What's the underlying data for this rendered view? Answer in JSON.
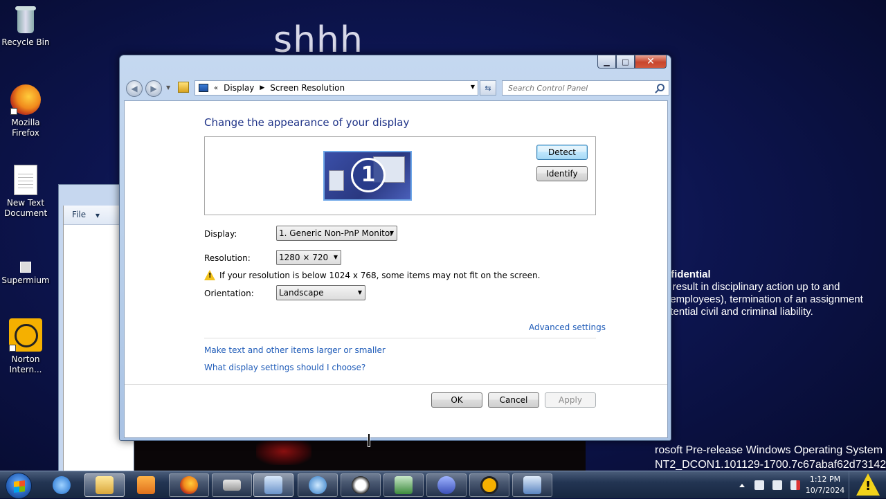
{
  "desktop": {
    "wallpaper_text": "shhh",
    "confidential_title": "nfidential",
    "confidential_lines": [
      "y result in disciplinary action up to and",
      "f employees), termination of an assignment",
      "otential civil and criminal liability."
    ],
    "build_lines": [
      "rosoft Pre-release Windows Operating System",
      "NT2_DCON1.101129-1700.7c67abaf62d73142"
    ],
    "icons": [
      {
        "label": "Recycle Bin",
        "icon": "recycle-bin-icon"
      },
      {
        "label": "Mozilla Firefox",
        "icon": "firefox-icon"
      },
      {
        "label": "New Text Document",
        "icon": "text-document-icon"
      },
      {
        "label": "Supermium",
        "icon": "supermium-icon"
      },
      {
        "label": "Norton Intern...",
        "icon": "norton-icon"
      }
    ]
  },
  "background_window": {
    "menu_file": "File"
  },
  "window": {
    "breadcrumb": [
      "Display",
      "Screen Resolution"
    ],
    "search_placeholder": "Search Control Panel",
    "heading": "Change the appearance of your display",
    "monitor_number": "1",
    "detect_label": "Detect",
    "identify_label": "Identify",
    "display_label": "Display:",
    "display_value": "1. Generic Non-PnP Monitor",
    "resolution_label": "Resolution:",
    "resolution_value": "1280 × 720",
    "warning_text": "If your resolution is below 1024 x 768, some items may not fit on the screen.",
    "orientation_label": "Orientation:",
    "orientation_value": "Landscape",
    "advanced_link": "Advanced settings",
    "link_text_size": "Make text and other items larger or smaller",
    "link_display_help": "What display settings should I choose?",
    "ok_label": "OK",
    "cancel_label": "Cancel",
    "apply_label": "Apply"
  },
  "taskbar": {
    "buttons": [
      "internet-explorer",
      "windows-explorer",
      "media-player",
      "firefox",
      "drive",
      "control-panel",
      "network",
      "panda",
      "task-manager",
      "bird-app",
      "norton",
      "display-settings"
    ],
    "clock_time": "1:12 PM",
    "clock_date": "10/7/2024"
  }
}
